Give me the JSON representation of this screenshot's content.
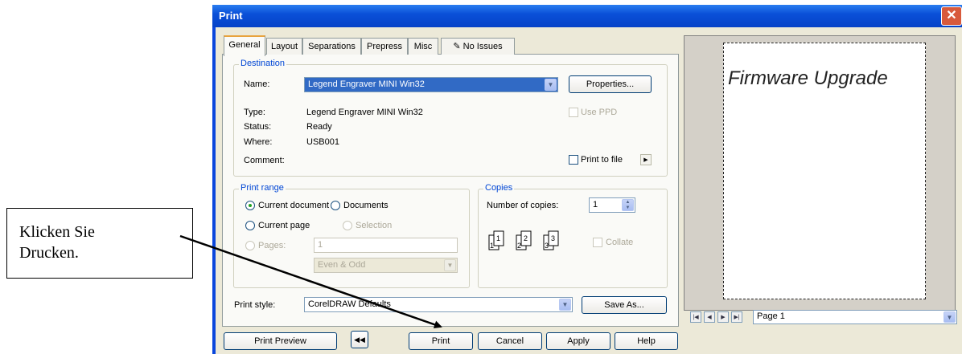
{
  "window": {
    "title": "Print"
  },
  "tabs": [
    {
      "label": "General"
    },
    {
      "label": "Layout"
    },
    {
      "label": "Separations"
    },
    {
      "label": "Prepress"
    },
    {
      "label": "Misc"
    },
    {
      "label": "No Issues"
    }
  ],
  "destination": {
    "group_label": "Destination",
    "name_label": "Name:",
    "name_value": "Legend Engraver MINI Win32",
    "properties_button": "Properties...",
    "type_label": "Type:",
    "type_value": "Legend Engraver MINI Win32",
    "use_ppd_label": "Use PPD",
    "status_label": "Status:",
    "status_value": "Ready",
    "where_label": "Where:",
    "where_value": "USB001",
    "comment_label": "Comment:",
    "print_to_file_label": "Print to file"
  },
  "print_range": {
    "group_label": "Print range",
    "current_document": "Current document",
    "documents": "Documents",
    "current_page": "Current page",
    "selection": "Selection",
    "pages_label": "Pages:",
    "pages_value": "1",
    "even_odd_value": "Even & Odd"
  },
  "copies": {
    "group_label": "Copies",
    "number_label": "Number of copies:",
    "number_value": "1",
    "collate_label": "Collate"
  },
  "print_style": {
    "label": "Print style:",
    "value": "CorelDRAW Defaults",
    "save_as_button": "Save As..."
  },
  "bottom_buttons": {
    "print_preview": "Print Preview",
    "print": "Print",
    "cancel": "Cancel",
    "apply": "Apply",
    "help": "Help"
  },
  "preview": {
    "page_text": "Firmware Upgrade",
    "page_selector": "Page 1"
  },
  "callout": {
    "line1": "Klicken Sie",
    "line2": "Drucken."
  },
  "colors": {
    "titlebar": "#0a50d8",
    "dialog_bg": "#ece9d8",
    "group_title": "#0046d5",
    "close_button": "#d85a3c"
  }
}
